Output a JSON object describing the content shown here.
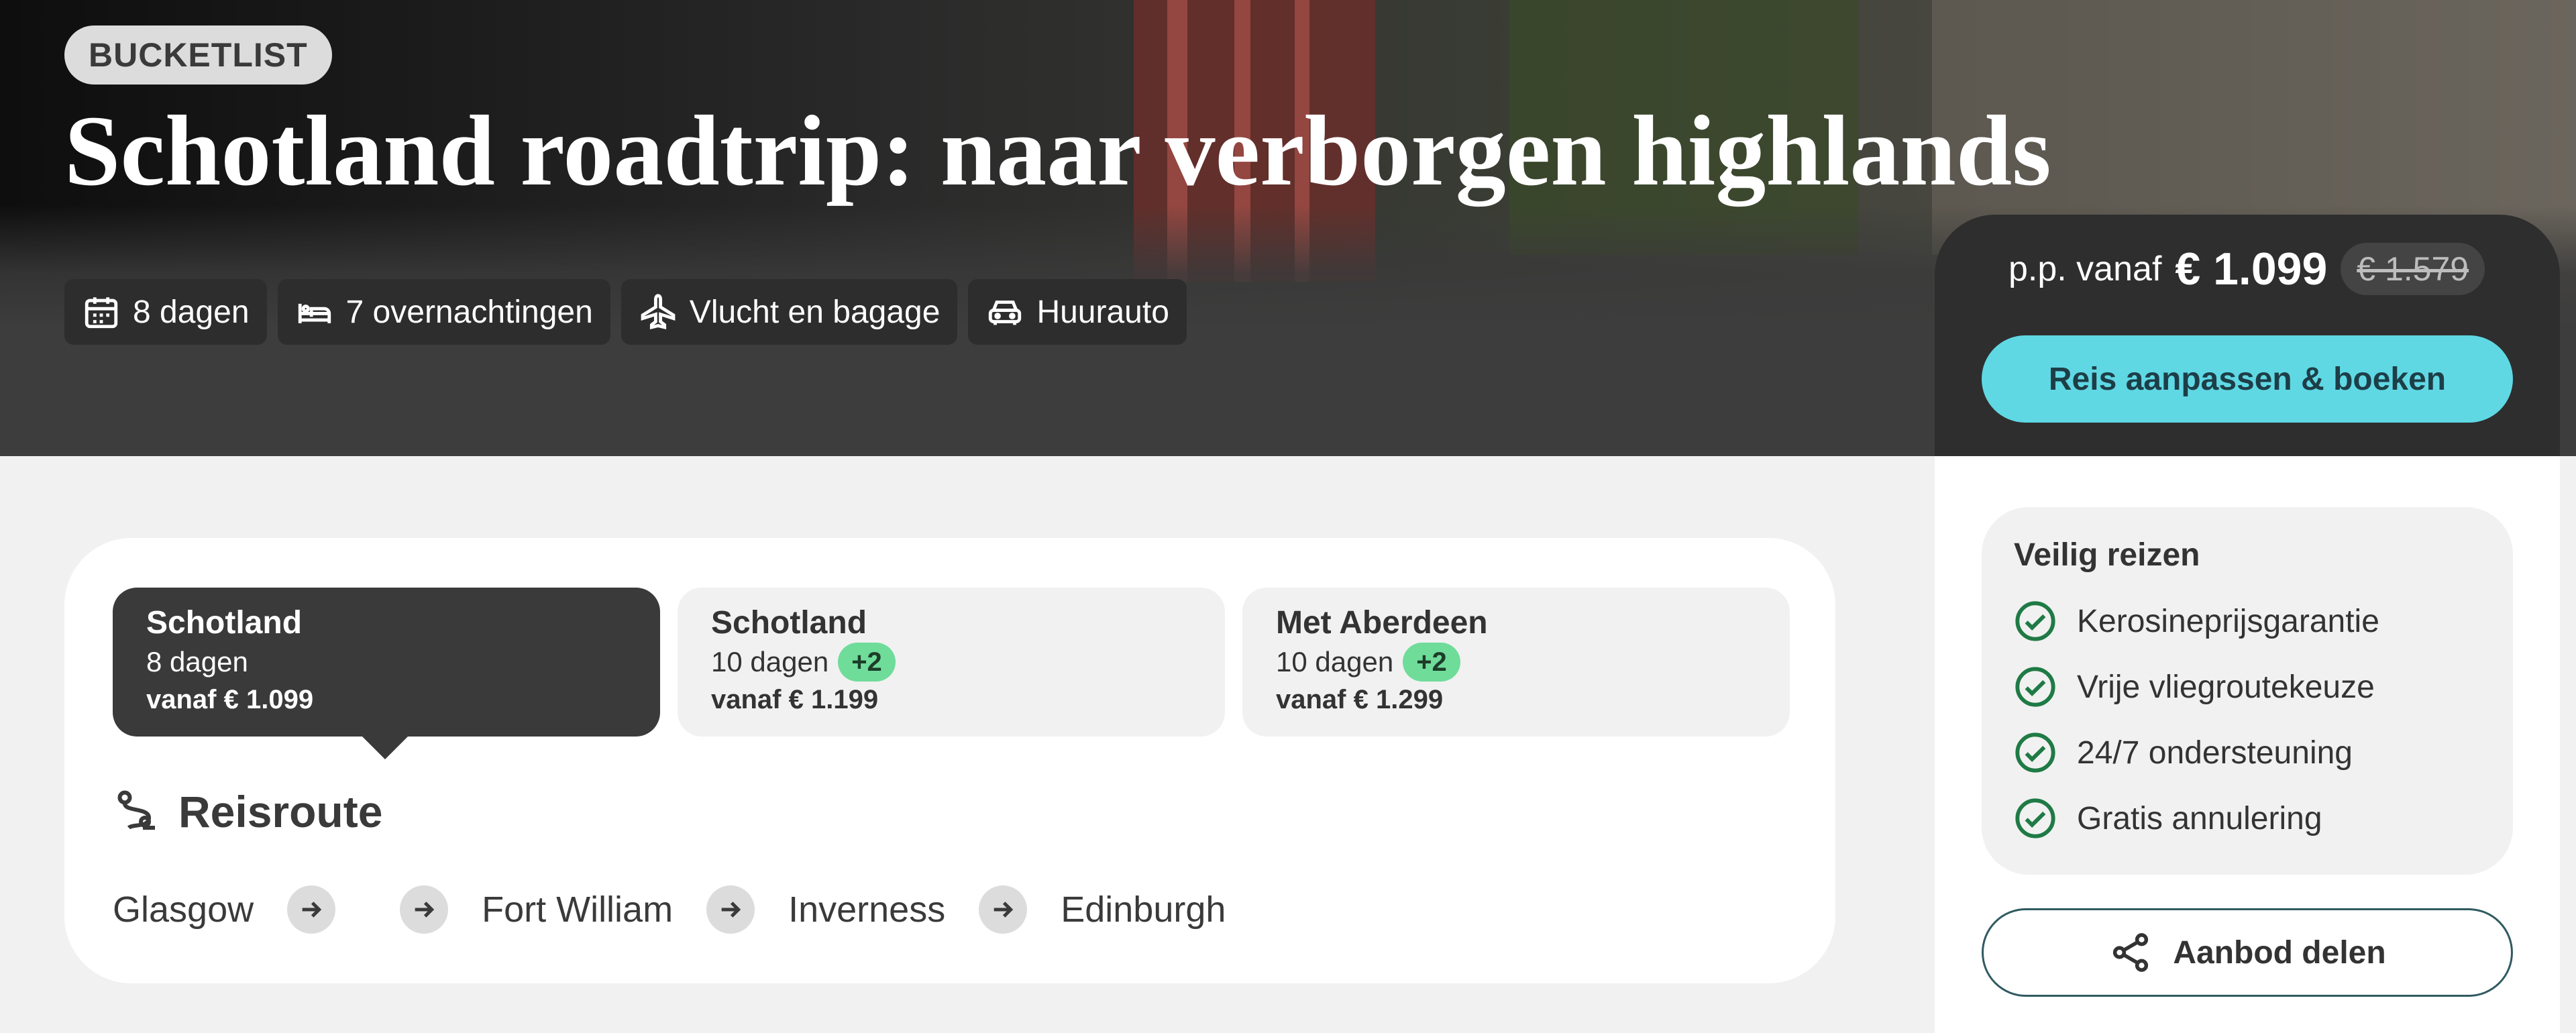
{
  "hero": {
    "badge": "BUCKETLIST",
    "title": "Schotland roadtrip: naar verborgen highlands",
    "features": [
      {
        "icon": "calendar-icon",
        "label": "8 dagen"
      },
      {
        "icon": "bed-icon",
        "label": "7 overnachtingen"
      },
      {
        "icon": "plane-icon",
        "label": "Vlucht en bagage"
      },
      {
        "icon": "car-icon",
        "label": "Huurauto"
      }
    ]
  },
  "booking": {
    "prefix": "p.p. vanaf",
    "price": "€ 1.099",
    "old_price": "€ 1.579",
    "button": "Reis aanpassen & boeken"
  },
  "variants": [
    {
      "name": "Schotland",
      "days": "8 dagen",
      "extra": "",
      "price": "vanaf € 1.099",
      "active": true
    },
    {
      "name": "Schotland",
      "days": "10 dagen",
      "extra": "+2",
      "price": "vanaf € 1.199",
      "active": false
    },
    {
      "name": "Met Aberdeen",
      "days": "10 dagen",
      "extra": "+2",
      "price": "vanaf € 1.299",
      "active": false
    }
  ],
  "route": {
    "title": "Reisroute",
    "stops": [
      "Glasgow",
      "Fort William",
      "Inverness",
      "Edinburgh"
    ]
  },
  "safety": {
    "title": "Veilig reizen",
    "items": [
      "Kerosineprijsgarantie",
      "Vrije vliegroutekeuze",
      "24/7 ondersteuning",
      "Gratis annulering"
    ]
  },
  "share": {
    "label": "Aanbod delen"
  },
  "colors": {
    "accent": "#5fd8e4",
    "check": "#1f7a45",
    "badge_green": "#6fdc9a",
    "dark": "#2e2e2e"
  }
}
